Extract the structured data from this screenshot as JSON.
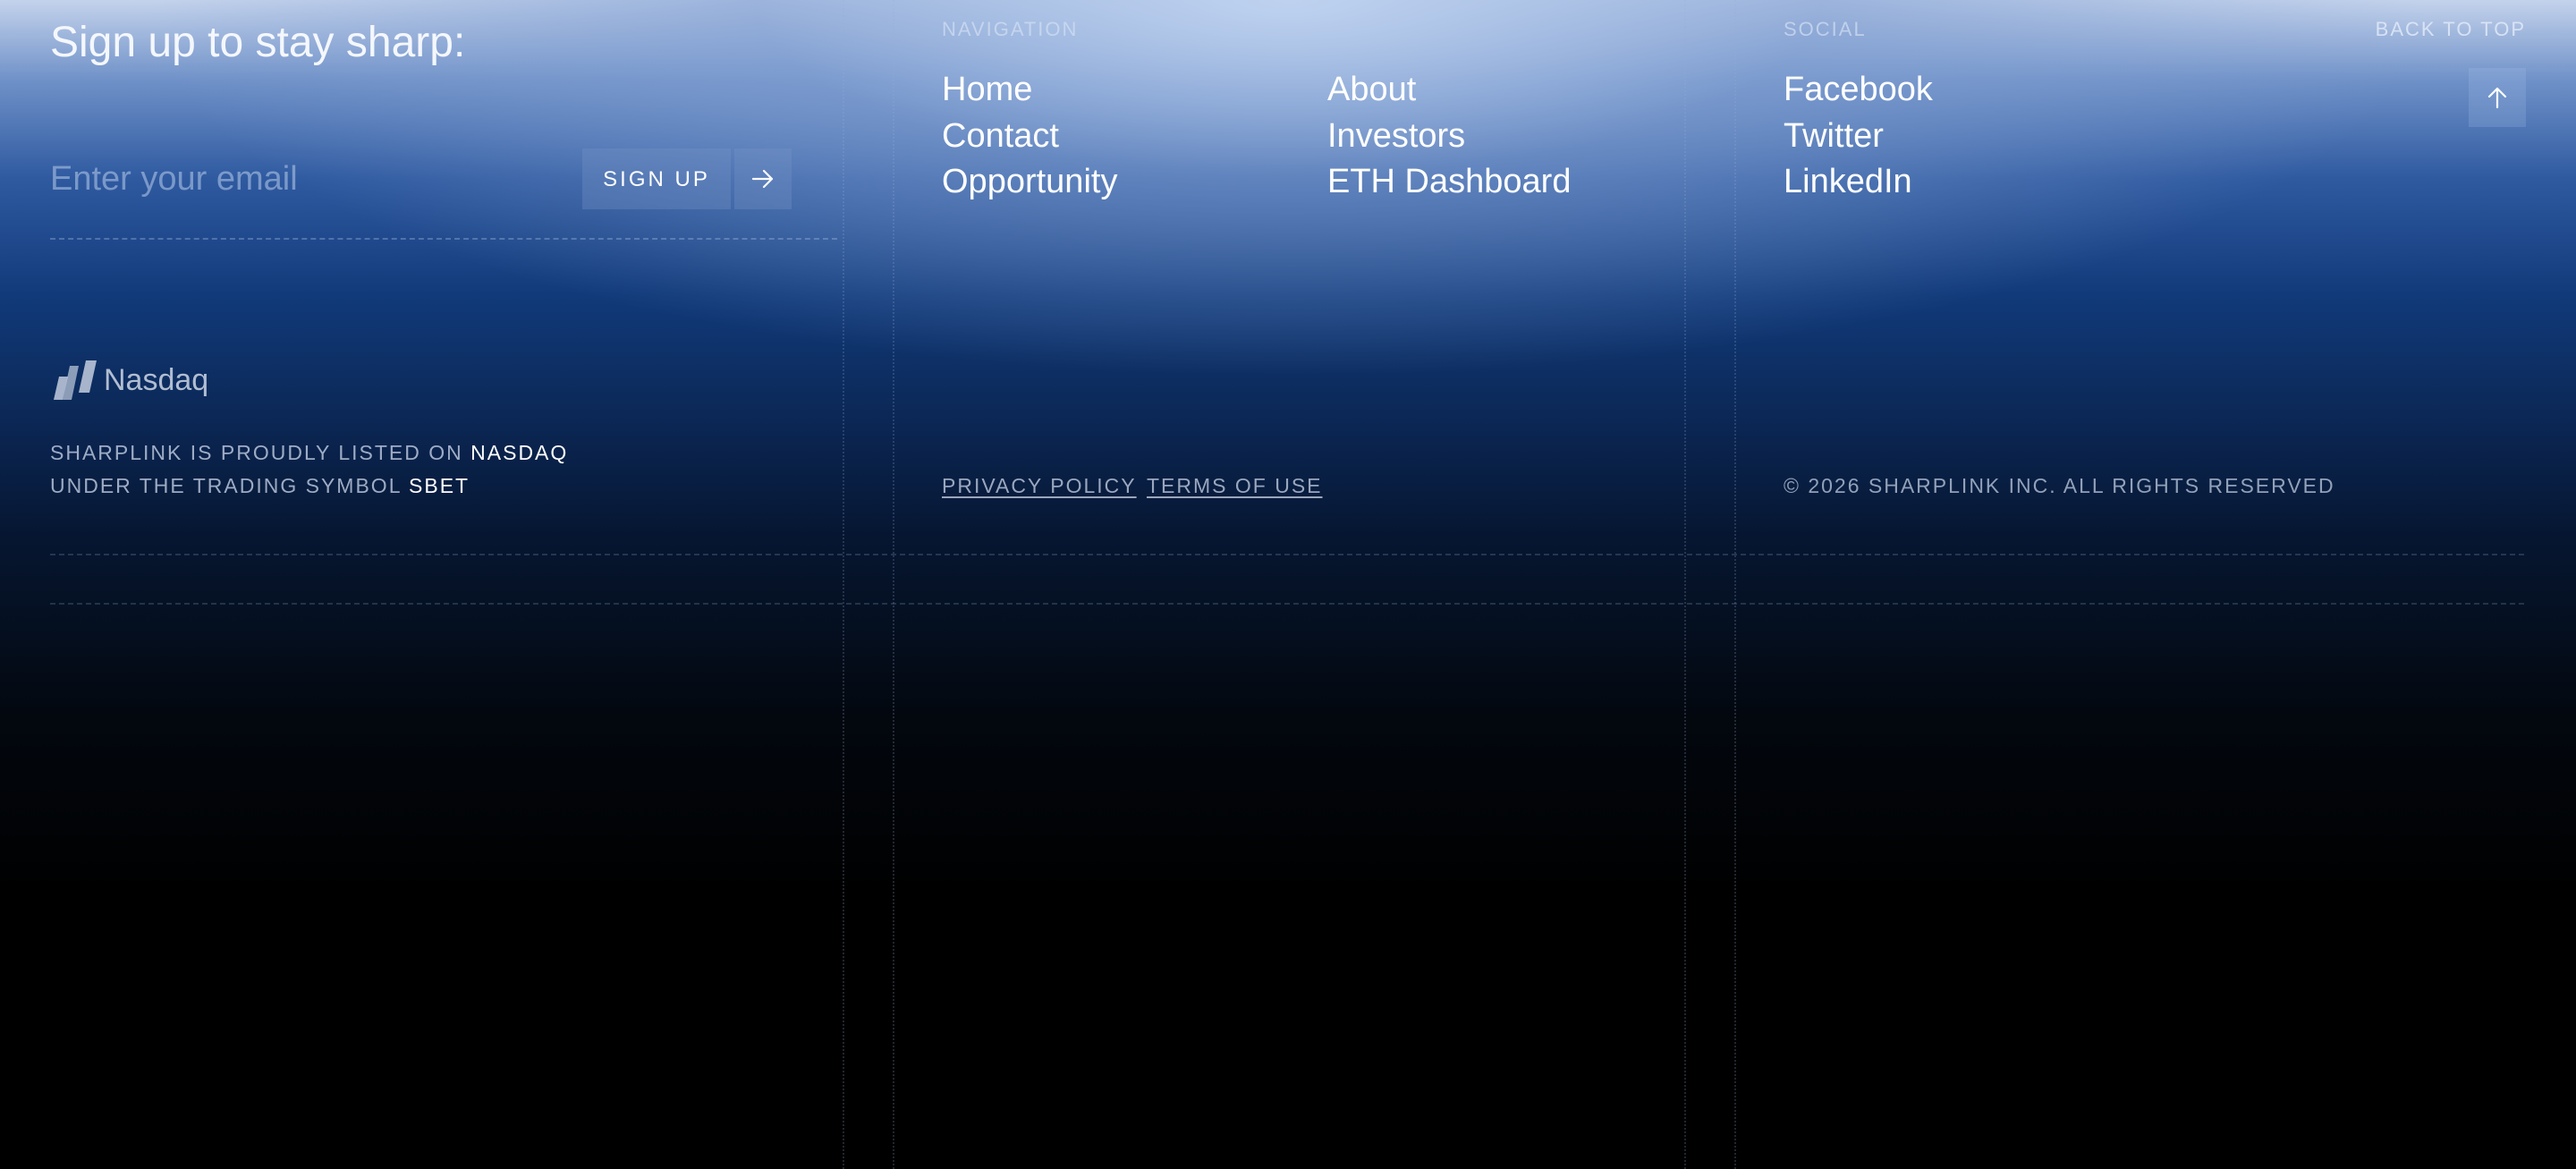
{
  "newsletter": {
    "title": "Sign up to stay sharp:",
    "email_placeholder": "Enter your email",
    "email_value": "",
    "signup_label": "SIGN UP",
    "submit_icon": "arrow-right-icon"
  },
  "navigation": {
    "label": "NAVIGATION",
    "links_col1": [
      "Home",
      "Contact",
      "Opportunity"
    ],
    "links_col2": [
      "About",
      "Investors",
      "ETH Dashboard"
    ]
  },
  "social": {
    "label": "SOCIAL",
    "links": [
      "Facebook",
      "Twitter",
      "LinkedIn"
    ]
  },
  "back_to_top": {
    "label": "BACK TO TOP",
    "icon": "arrow-up-icon"
  },
  "listing": {
    "logo_text": "Nasdaq",
    "line1_prefix": "SHARPLINK IS PROUDLY LISTED ON",
    "line1_highlight": "NASDAQ",
    "line2_prefix": "UNDER THE TRADING SYMBOL",
    "line2_highlight": "SBET"
  },
  "legal": {
    "privacy": "PRIVACY POLICY",
    "terms": "TERMS OF USE",
    "copyright": "© 2026 SHARPLINK INC. ALL RIGHTS RESERVED"
  },
  "colors": {
    "text": "#ffffff",
    "accent_blue": "#2f5aa0",
    "deep_navy": "#0b2755",
    "background_dark": "#000000"
  }
}
